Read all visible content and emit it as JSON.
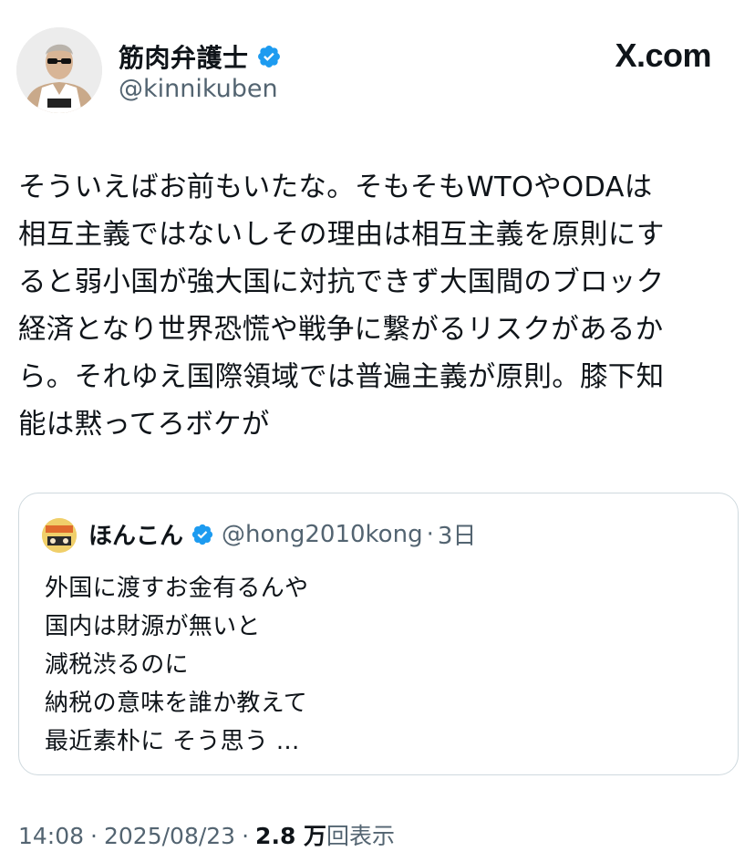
{
  "author": {
    "display_name": "筋肉弁護士",
    "handle": "@kinnikuben"
  },
  "brand": "X.com",
  "tweet": {
    "text": "そういえばお前もいたな。そもそもWTOやODAは\n相互主義ではないしその理由は相互主義を原則にす\nると弱小国が強大国に対抗できず大国間のブロック\n経済となり世界恐慌や戦争に繋がるリスクがあるか\nら。それゆえ国際領域では普遍主義が原則。膝下知\n能は黙ってろボケが"
  },
  "quoted_tweet": {
    "display_name": "ほんこん",
    "handle": "@hong2010kong",
    "separator": "·",
    "time": "3日",
    "text": "外国に渡すお金有るんや\n国内は財源が無いと\n減税渋るのに\n納税の意味を誰か教えて\n最近素朴に そう思う ..."
  },
  "meta": {
    "time": "14:08",
    "separator": "·",
    "date": "2025/08/23",
    "views_count": "2.8 万",
    "views_label": "回表示"
  },
  "colors": {
    "verified_blue": "#1d9bf0",
    "secondary_text": "#536471",
    "primary_text": "#0f1419",
    "border": "#cfd9de"
  }
}
